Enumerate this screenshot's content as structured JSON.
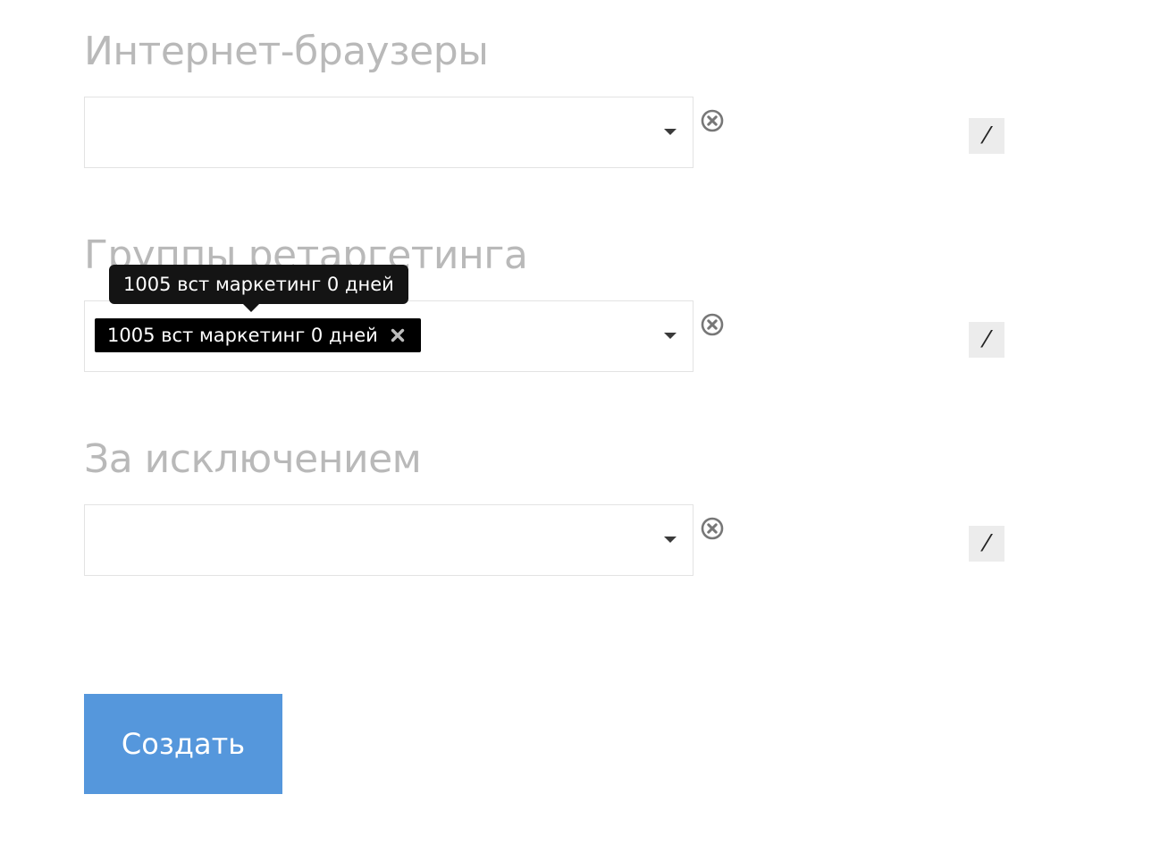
{
  "sections": [
    {
      "title": "Интернет-браузеры",
      "selected_tag": ""
    },
    {
      "title": "Группы ретаргетинга",
      "selected_tag": "1005 вст маркетинг 0 дней"
    },
    {
      "title": "За исключением",
      "selected_tag": ""
    }
  ],
  "tooltip": {
    "text": "1005 вст маркетинг 0 дней"
  },
  "edit_glyph": "⁄",
  "actions": {
    "create_label": "Создать"
  },
  "colors": {
    "title": "#b9b9b9",
    "tag_bg": "#000000",
    "tooltip_bg": "#141414",
    "create_button": "#5597dc",
    "edit_button_bg": "#ececec"
  },
  "icons": [
    "chevron-down-icon",
    "clear-circle-x-icon",
    "edit-slash-icon",
    "remove-x-icon"
  ]
}
